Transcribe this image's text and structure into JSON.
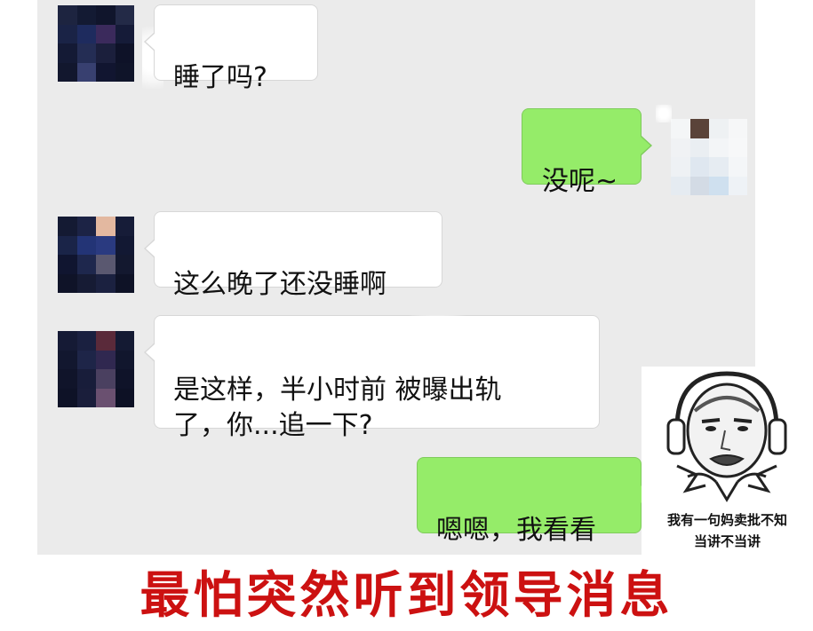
{
  "messages": [
    {
      "side": "left",
      "text": "睡了吗?"
    },
    {
      "side": "right",
      "text": "没呢~"
    },
    {
      "side": "left",
      "text": "这么晚了还没睡啊"
    },
    {
      "side": "left",
      "text": "是这样，半小时前    被曝出轨\n了，你...追一下?"
    },
    {
      "side": "right",
      "text": "嗯嗯，我看看"
    }
  ],
  "meme": {
    "icon": "headphone-meme-face",
    "caption_line1": "我有一句妈卖批不知",
    "caption_line2": "当讲不当讲"
  },
  "headline": "最怕突然听到领导消息",
  "colors": {
    "chat_background": "#ebebeb",
    "left_bubble": "#ffffff",
    "right_bubble": "#95ec69",
    "headline": "#cc1111"
  }
}
